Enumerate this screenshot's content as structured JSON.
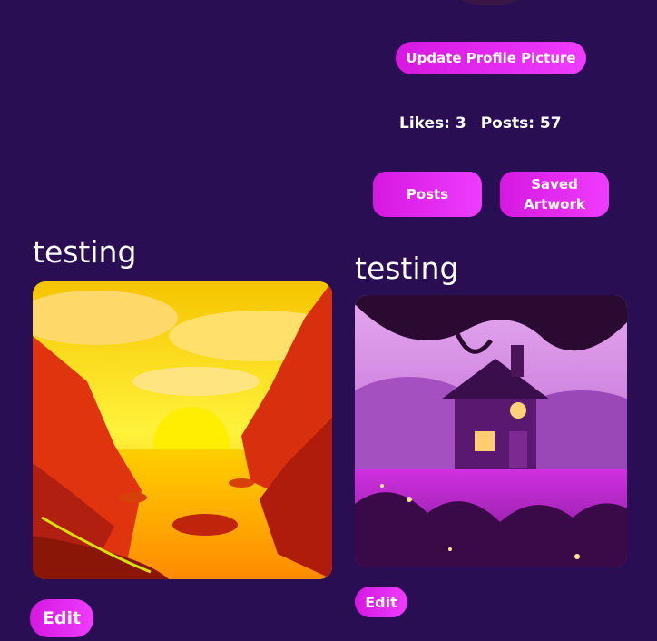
{
  "profile": {
    "update_picture_label": "Update Profile Picture",
    "likes_label": "Likes: 3",
    "posts_label": "Posts: 57"
  },
  "tabs": {
    "posts": "Posts",
    "saved_line1": "Saved",
    "saved_line2": "Artwork"
  },
  "posts": [
    {
      "title": "testing",
      "edit_label": "Edit"
    },
    {
      "title": "testing",
      "edit_label": "Edit"
    }
  ],
  "colors": {
    "background": "#2a0e53",
    "accent": "#e32df0"
  }
}
